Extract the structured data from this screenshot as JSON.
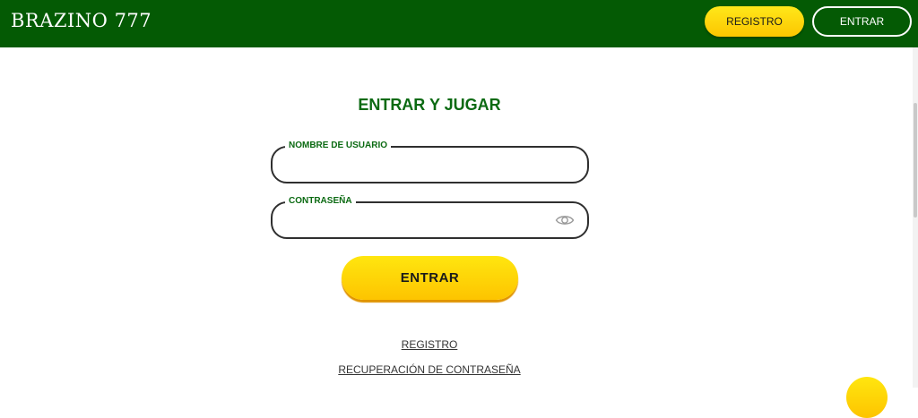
{
  "header": {
    "logo": "BRAZINO 777",
    "register_label": "REGISTRO",
    "login_label": "ENTRAR"
  },
  "form": {
    "title": "ENTRAR Y JUGAR",
    "username_label": "NOMBRE DE USUARIO",
    "username_value": "",
    "password_label": "CONTRASEÑA",
    "password_value": "",
    "password_toggle_icon": "eye-icon",
    "submit_label": "ENTRAR"
  },
  "links": {
    "register": "REGISTRO",
    "recover_password": "RECUPERACIÓN DE CONTRASEÑA"
  },
  "colors": {
    "header_bg": "#045a04",
    "accent_yellow": "#fdc400",
    "title_green": "#0b6a12"
  }
}
